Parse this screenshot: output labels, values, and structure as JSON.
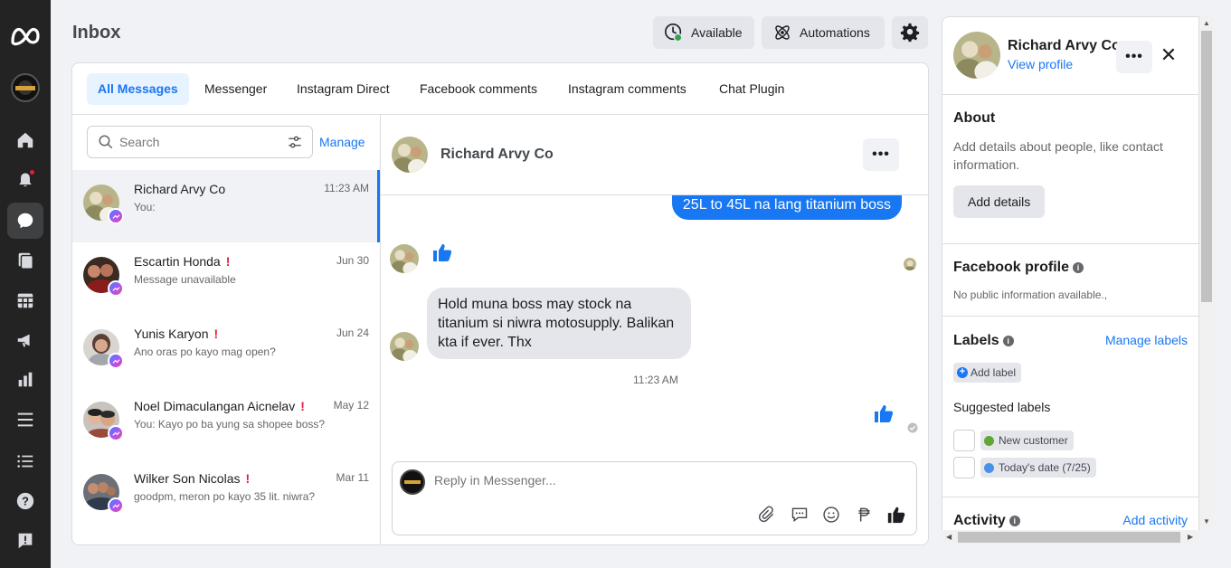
{
  "app": {
    "title": "Inbox"
  },
  "header": {
    "status_label": "Available",
    "automations_label": "Automations"
  },
  "tabs": [
    {
      "label": "All Messages",
      "active": true
    },
    {
      "label": "Messenger",
      "active": false
    },
    {
      "label": "Instagram Direct",
      "active": false
    },
    {
      "label": "Facebook comments",
      "active": false
    },
    {
      "label": "Instagram comments",
      "active": false
    },
    {
      "label": "Chat Plugin",
      "active": false
    }
  ],
  "search": {
    "placeholder": "Search",
    "manage_label": "Manage"
  },
  "conversations": [
    {
      "name": "Richard Arvy Co",
      "snippet": "You:",
      "time": "11:23 AM",
      "flagged": false,
      "active": true
    },
    {
      "name": "Escartin Honda",
      "snippet": "Message unavailable",
      "time": "Jun 30",
      "flagged": true,
      "flag": "!",
      "active": false
    },
    {
      "name": "Yunis Karyon",
      "snippet": "Ano oras po kayo mag open?",
      "time": "Jun 24",
      "flagged": true,
      "flag": "!",
      "active": false
    },
    {
      "name": "Noel Dimaculangan Aicnelav",
      "snippet": "You: Kayo po ba yung sa shopee boss?",
      "time": "May 12",
      "flagged": true,
      "flag": "!",
      "active": false
    },
    {
      "name": "Wilker Son Nicolas",
      "snippet": "goodpm, meron po kayo 35 lit. niwra?",
      "time": "Mar 11",
      "flagged": true,
      "flag": "!",
      "active": false
    }
  ],
  "chat": {
    "contact_name": "Richard Arvy Co",
    "more_label": "•••",
    "outgoing_message": "25L to 45L na lang titanium boss",
    "incoming_message": "Hold muna boss may stock na titanium si niwra motosupply.  Balikan kta if ever. Thx",
    "timestamp": "11:23 AM",
    "reply_placeholder": "Reply in Messenger..."
  },
  "profile": {
    "name": "Richard Arvy Co",
    "view_profile_label": "View profile",
    "more_label": "•••",
    "close_label": "✕",
    "about_heading": "About",
    "about_text": "Add details about people, like contact information.",
    "add_details_label": "Add details",
    "facebook_profile_heading": "Facebook profile",
    "facebook_profile_text": "No public information available.,",
    "labels_heading": "Labels",
    "manage_labels_label": "Manage labels",
    "add_label_label": "Add label",
    "suggested_labels_heading": "Suggested labels",
    "suggested_labels": [
      {
        "label": "New customer",
        "color": "#5fa836"
      },
      {
        "label": "Today's date (7/25)",
        "color": "#4a90e8"
      }
    ],
    "activity_heading": "Activity",
    "add_activity_label": "Add activity"
  },
  "colors": {
    "accent": "#1877f2",
    "rail_bg": "#232323",
    "flag": "#e41e3f",
    "status_online": "#31a24c"
  }
}
